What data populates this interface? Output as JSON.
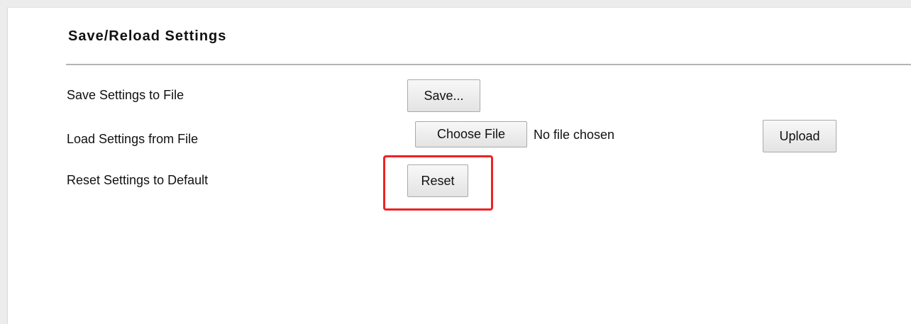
{
  "section": {
    "title": "Save/Reload Settings"
  },
  "rows": {
    "save": {
      "label": "Save Settings to File",
      "button_label": "Save..."
    },
    "load": {
      "label": "Load Settings from File",
      "choose_button_label": "Choose File",
      "file_status": "No file chosen",
      "upload_button_label": "Upload"
    },
    "reset": {
      "label": "Reset Settings to Default",
      "button_label": "Reset"
    }
  },
  "annotation": {
    "highlight_color": "#ee2222"
  }
}
